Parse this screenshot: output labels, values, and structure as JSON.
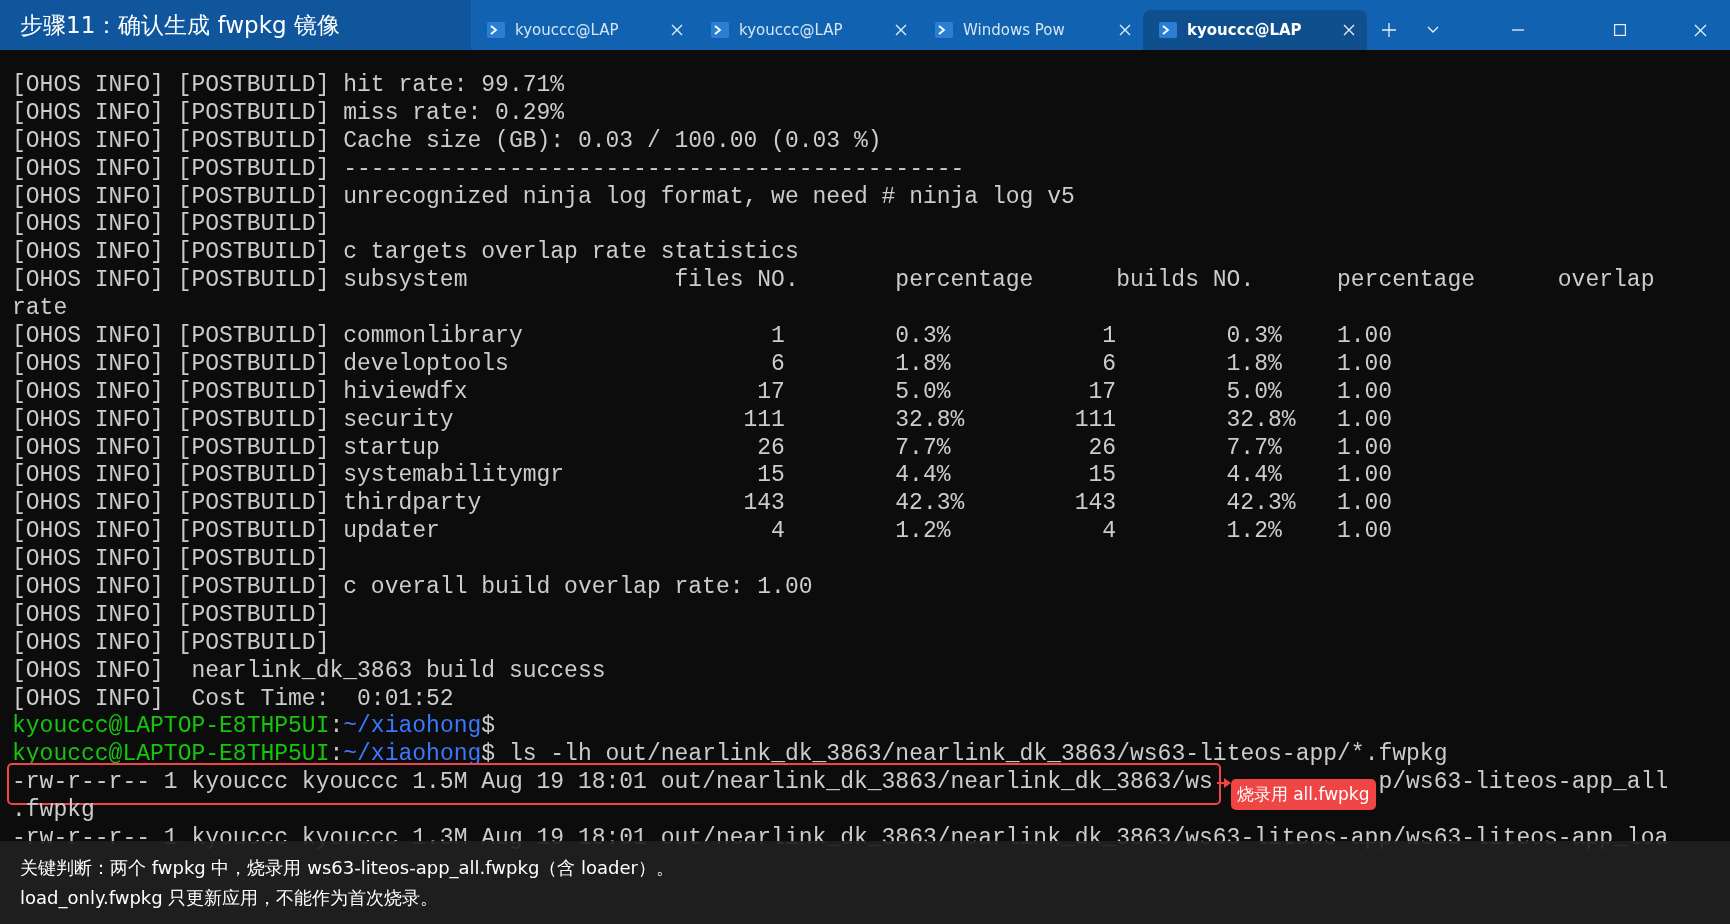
{
  "caption": "步骤11：确认生成 fwpkg 镜像",
  "tabs": [
    {
      "label": "kyouccc@LAP",
      "selected": false
    },
    {
      "label": "kyouccc@LAP",
      "selected": false
    },
    {
      "label": "Windows Pow",
      "selected": false
    },
    {
      "label": "kyouccc@LAP",
      "selected": true
    }
  ],
  "terminal": [
    {
      "kind": "text",
      "text": "[OHOS INFO] [POSTBUILD] hit rate: 99.71%"
    },
    {
      "kind": "text",
      "text": "[OHOS INFO] [POSTBUILD] miss rate: 0.29%"
    },
    {
      "kind": "text",
      "text": "[OHOS INFO] [POSTBUILD] Cache size (GB): 0.03 / 100.00 (0.03 %)"
    },
    {
      "kind": "text",
      "text": "[OHOS INFO] [POSTBUILD] ---------------------------------------------"
    },
    {
      "kind": "text",
      "text": "[OHOS INFO] [POSTBUILD] unrecognized ninja log format, we need # ninja log v5"
    },
    {
      "kind": "text",
      "text": "[OHOS INFO] [POSTBUILD]"
    },
    {
      "kind": "text",
      "text": "[OHOS INFO] [POSTBUILD] c targets overlap rate statistics"
    },
    {
      "kind": "header",
      "prefix": "[OHOS INFO] [POSTBUILD]",
      "cells": [
        "subsystem",
        "files NO.",
        "percentage",
        "builds NO.",
        "percentage",
        "overlap"
      ]
    },
    {
      "kind": "text",
      "text": "rate"
    },
    {
      "kind": "row",
      "prefix": "[OHOS INFO] [POSTBUILD]",
      "cells": [
        "commonlibrary",
        "1",
        "0.3%",
        "1",
        "0.3%",
        "1.00"
      ]
    },
    {
      "kind": "row",
      "prefix": "[OHOS INFO] [POSTBUILD]",
      "cells": [
        "developtools",
        "6",
        "1.8%",
        "6",
        "1.8%",
        "1.00"
      ]
    },
    {
      "kind": "row",
      "prefix": "[OHOS INFO] [POSTBUILD]",
      "cells": [
        "hiviewdfx",
        "17",
        "5.0%",
        "17",
        "5.0%",
        "1.00"
      ]
    },
    {
      "kind": "row",
      "prefix": "[OHOS INFO] [POSTBUILD]",
      "cells": [
        "security",
        "111",
        "32.8%",
        "111",
        "32.8%",
        "1.00"
      ]
    },
    {
      "kind": "row",
      "prefix": "[OHOS INFO] [POSTBUILD]",
      "cells": [
        "startup",
        "26",
        "7.7%",
        "26",
        "7.7%",
        "1.00"
      ]
    },
    {
      "kind": "row",
      "prefix": "[OHOS INFO] [POSTBUILD]",
      "cells": [
        "systemabilitymgr",
        "15",
        "4.4%",
        "15",
        "4.4%",
        "1.00"
      ]
    },
    {
      "kind": "row",
      "prefix": "[OHOS INFO] [POSTBUILD]",
      "cells": [
        "thirdparty",
        "143",
        "42.3%",
        "143",
        "42.3%",
        "1.00"
      ]
    },
    {
      "kind": "row",
      "prefix": "[OHOS INFO] [POSTBUILD]",
      "cells": [
        "updater",
        "4",
        "1.2%",
        "4",
        "1.2%",
        "1.00"
      ]
    },
    {
      "kind": "text",
      "text": "[OHOS INFO] [POSTBUILD]"
    },
    {
      "kind": "text",
      "text": "[OHOS INFO] [POSTBUILD] c overall build overlap rate: 1.00"
    },
    {
      "kind": "text",
      "text": "[OHOS INFO] [POSTBUILD]"
    },
    {
      "kind": "text",
      "text": "[OHOS INFO] [POSTBUILD]"
    },
    {
      "kind": "text",
      "text": "[OHOS INFO]  nearlink_dk_3863 build success"
    },
    {
      "kind": "text",
      "text": "[OHOS INFO]  Cost Time:  0:01:52"
    },
    {
      "kind": "prompt",
      "user": "kyouccc@LAPTOP-E8THP5UI",
      "separator": ":",
      "path": "~/xiaohong",
      "symbol": "$"
    },
    {
      "kind": "prompt",
      "user": "kyouccc@LAPTOP-E8THP5UI",
      "separator": ":",
      "path": "~/xiaohong",
      "symbol": "$",
      "command": " ls -lh out/nearlink_dk_3863/nearlink_dk_3863/ws63-liteos-app/*.fwpkg"
    },
    {
      "kind": "annotated",
      "before": "-rw-r--r-- 1 kyouccc kyouccc 1.5M Aug 19 18:01 out/nearlink_dk_3863/nearlink_dk_3863/ws",
      "after": "p/ws63-liteos-app_all",
      "callout": "烧录用 all.fwpkg"
    },
    {
      "kind": "text",
      "text": ".fwpkg"
    },
    {
      "kind": "text",
      "text": "-rw-r--r-- 1 kyouccc kyouccc 1.3M Aug 19 18:01 out/nearlink_dk_3863/nearlink_dk_3863/ws63-liteos-app/ws63-liteos-app_loa"
    }
  ],
  "note": [
    "关键判断：两个 fwpkg 中，烧录用 ws63-liteos-app_all.fwpkg（含 loader）。",
    "load_only.fwpkg 只更新应用，不能作为首次烧录。"
  ]
}
